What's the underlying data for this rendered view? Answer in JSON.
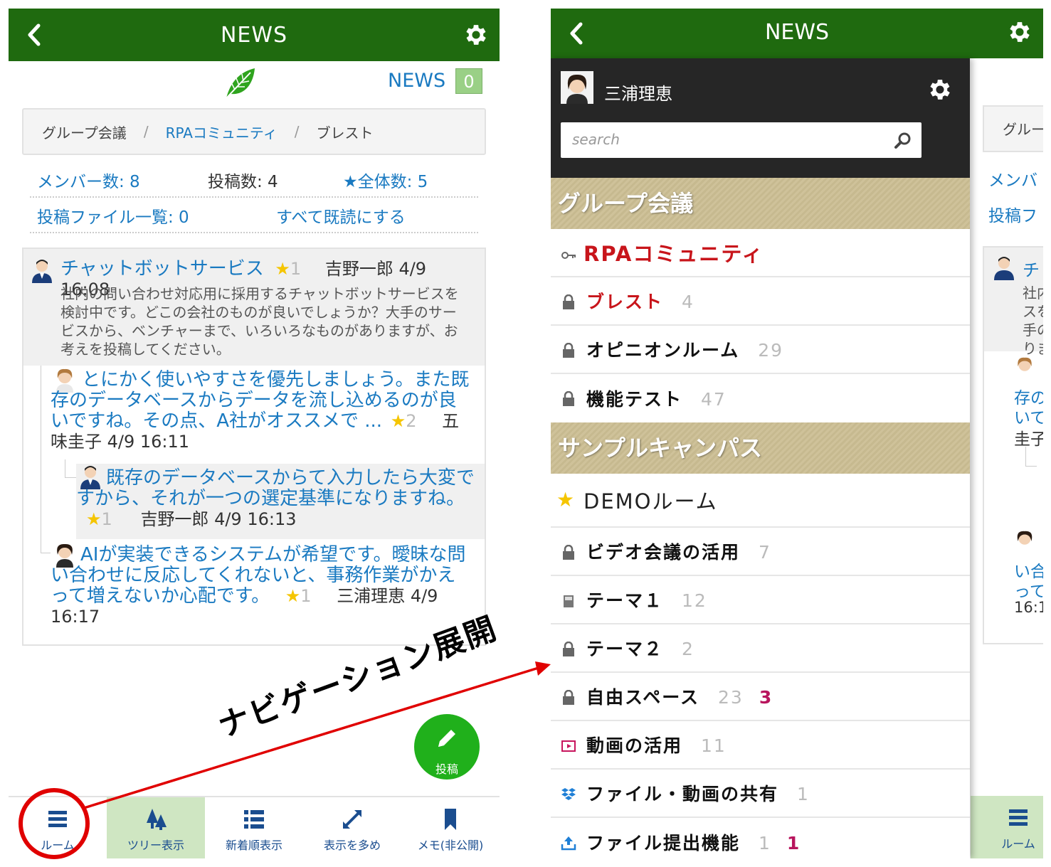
{
  "header": {
    "title": "NEWS"
  },
  "subbar": {
    "news_label": "NEWS",
    "news_count": "0"
  },
  "breadcrumb": {
    "item1": "グループ会議",
    "sep": "/",
    "item2": "RPAコミュニティ",
    "item3": "ブレスト"
  },
  "stats": {
    "members": "メンバー数: 8",
    "posts": "投稿数: 4",
    "star": "★",
    "total": "全体数: 5",
    "files": "投稿ファイル一覧: 0",
    "mark_read": "すべて既読にする"
  },
  "thread": {
    "post1": {
      "title": "チャットボットサービス",
      "star": "★",
      "stars": "1",
      "meta": "吉野一郎 4/9 16:08",
      "body": "社内の問い合わせ対応用に採用するチャットボットサービスを検討中です。どこの会社のものが良いでしょうか？大手のサービスから、ベンチャーまで、いろいろなものがありますが、お考えを投稿してください。"
    },
    "post2": {
      "title": "とにかく使いやすさを優先しましょう。また既存のデータベースからデータを流し込めるのが良いですね。その点、A社がオススメで ...",
      "star": "★",
      "stars": "2",
      "meta": "五味圭子 4/9 16:11"
    },
    "post3": {
      "title": "既存のデータベースからて入力したら大変ですから、それが一つの選定基準になりますね。",
      "star": "★",
      "stars": "1",
      "meta": "吉野一郎 4/9 16:13"
    },
    "post4": {
      "title": "AIが実装できるシステムが希望です。曖昧な問い合わせに反応してくれないと、事務作業がかえって増えないか心配です。",
      "star": "★",
      "stars": "1",
      "meta": "三浦理恵 4/9 16:17"
    }
  },
  "fab": {
    "label": "投稿"
  },
  "tabbar": {
    "room": "ルーム",
    "tree": "ツリー表示",
    "newest": "新着順表示",
    "more": "表示を多め",
    "memo": "メモ(非公開)"
  },
  "annotation": {
    "text": "ナビゲーション展開"
  },
  "drawer": {
    "user": "三浦理恵",
    "search_placeholder": "search",
    "groups": [
      {
        "name": "グループ会議"
      },
      {
        "name": "サンプルキャンパス"
      }
    ],
    "rooms_g1": [
      {
        "name": "RPAコミュニティ",
        "count": "",
        "new": "",
        "icon": "key-icon"
      },
      {
        "name": "ブレスト",
        "count": "4",
        "new": "",
        "icon": "lock-icon"
      },
      {
        "name": "オピニオンルーム",
        "count": "29",
        "new": "",
        "icon": "lock-icon"
      },
      {
        "name": "機能テスト",
        "count": "47",
        "new": "",
        "icon": "lock-icon"
      }
    ],
    "rooms_g2": [
      {
        "name": "DEMOルーム",
        "count": "",
        "new": "",
        "icon": "star-icon"
      },
      {
        "name": "ビデオ会議の活用",
        "count": "7",
        "new": "",
        "icon": "lock-icon"
      },
      {
        "name": "テーマ１",
        "count": "12",
        "new": "",
        "icon": "book-icon"
      },
      {
        "name": "テーマ２",
        "count": "2",
        "new": "",
        "icon": "lock-icon"
      },
      {
        "name": "自由スペース",
        "count": "23",
        "new": "3",
        "icon": "lock-icon"
      },
      {
        "name": "動画の活用",
        "count": "11",
        "new": "",
        "icon": "video-icon"
      },
      {
        "name": "ファイル・動画の共有",
        "count": "1",
        "new": "",
        "icon": "dropbox-icon"
      },
      {
        "name": "ファイル提出機能",
        "count": "1",
        "new": "1",
        "icon": "upload-icon"
      }
    ]
  },
  "peek": {
    "crumb": "グルー",
    "members": "メンバ",
    "files": "投稿フ",
    "lines": [
      "チ",
      "社内",
      "スを",
      "手の",
      "りま",
      "存の",
      "いて",
      "圭子",
      "い合",
      "って",
      "16:1"
    ],
    "tab": "ルーム"
  },
  "colors": {
    "header_green": "#1f6a0f",
    "link_blue": "#1a7ac1",
    "accent_red": "#c8151b",
    "annotation_red": "#e00000"
  }
}
